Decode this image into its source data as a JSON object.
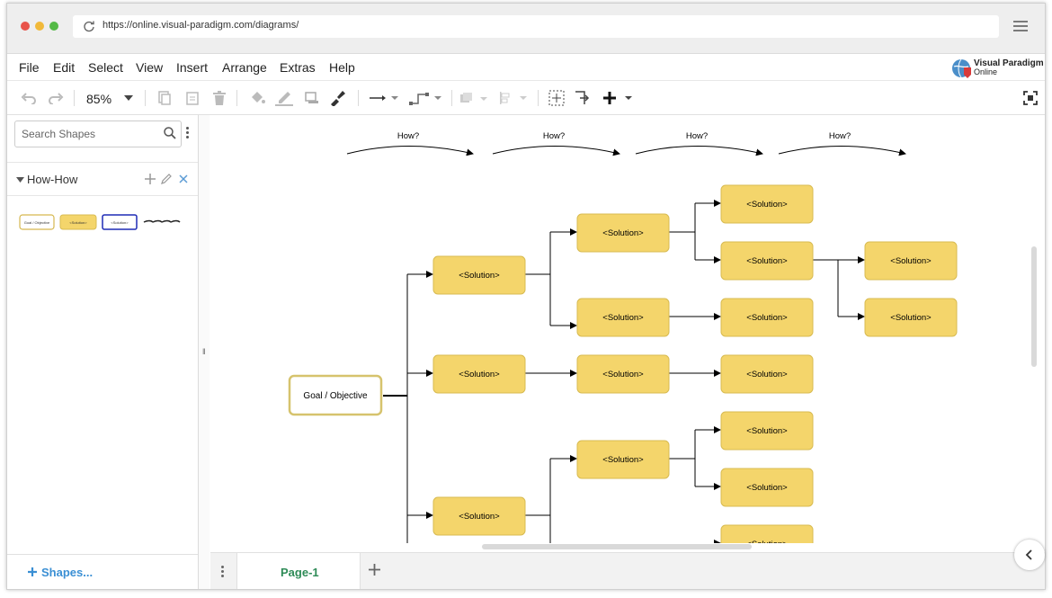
{
  "browser": {
    "url": "https://online.visual-paradigm.com/diagrams/",
    "traffic_colors": [
      "#e8534a",
      "#f1b93a",
      "#54b946"
    ]
  },
  "menu": {
    "items": [
      "File",
      "Edit",
      "Select",
      "View",
      "Insert",
      "Arrange",
      "Extras",
      "Help"
    ]
  },
  "logo": {
    "line1": "Visual Paradigm",
    "line2": "Online"
  },
  "toolbar": {
    "zoom": "85%"
  },
  "sidebar": {
    "search_placeholder": "Search Shapes",
    "section_title": "How-How",
    "shapes_button": "Shapes..."
  },
  "diagram": {
    "how_labels": [
      "How?",
      "How?",
      "How?",
      "How?"
    ],
    "goal_label": "Goal / Objective",
    "solution_label": "<Solution>",
    "node_fill": "#f4d56b",
    "node_stroke": "#d8bb52",
    "goal_stroke": "#d6c36d"
  },
  "pagebar": {
    "page_name": "Page-1"
  },
  "colors": {
    "accent": "#3a8fd4",
    "page_tab": "#2e8b57"
  }
}
